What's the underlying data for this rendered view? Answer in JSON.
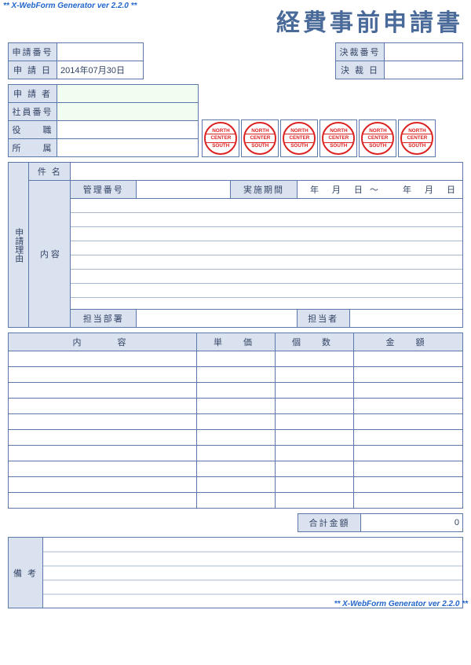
{
  "watermark": "** X-WebForm Generator ver 2.2.0 **",
  "title": "経費事前申請書",
  "appNo": {
    "label": "申請番号",
    "value": ""
  },
  "appDate": {
    "label": "申 請 日",
    "value": "2014年07月30日"
  },
  "approvalNo": {
    "label": "決裁番号",
    "value": ""
  },
  "approvalDate": {
    "label": "決 裁 日",
    "value": ""
  },
  "applicant": {
    "name": {
      "label": "申 請 者",
      "value": ""
    },
    "empNo": {
      "label": "社員番号",
      "value": ""
    },
    "title": {
      "label": "役　　職",
      "value": ""
    },
    "dept": {
      "label": "所　　属",
      "value": ""
    }
  },
  "stamps": {
    "top": "NORTH",
    "mid": "CENTER",
    "bot": "SOUTH"
  },
  "reason": {
    "sideLabel": "申請理由",
    "subjectLabel": "件 名",
    "mgmtNoLabel": "管理番号",
    "periodLabel": "実施期間",
    "periodValue": "年　月　日 ～　　年　月　日",
    "contentLabel": "内 容",
    "deptLabel": "担当部署",
    "personLabel": "担当者"
  },
  "items": {
    "headers": {
      "desc": "内　　容",
      "unit": "単　価",
      "qty": "個　数",
      "amount": "金　額"
    },
    "rows": 10,
    "totalLabel": "合計金額",
    "totalValue": "0"
  },
  "remarks": {
    "label": "備 考"
  }
}
